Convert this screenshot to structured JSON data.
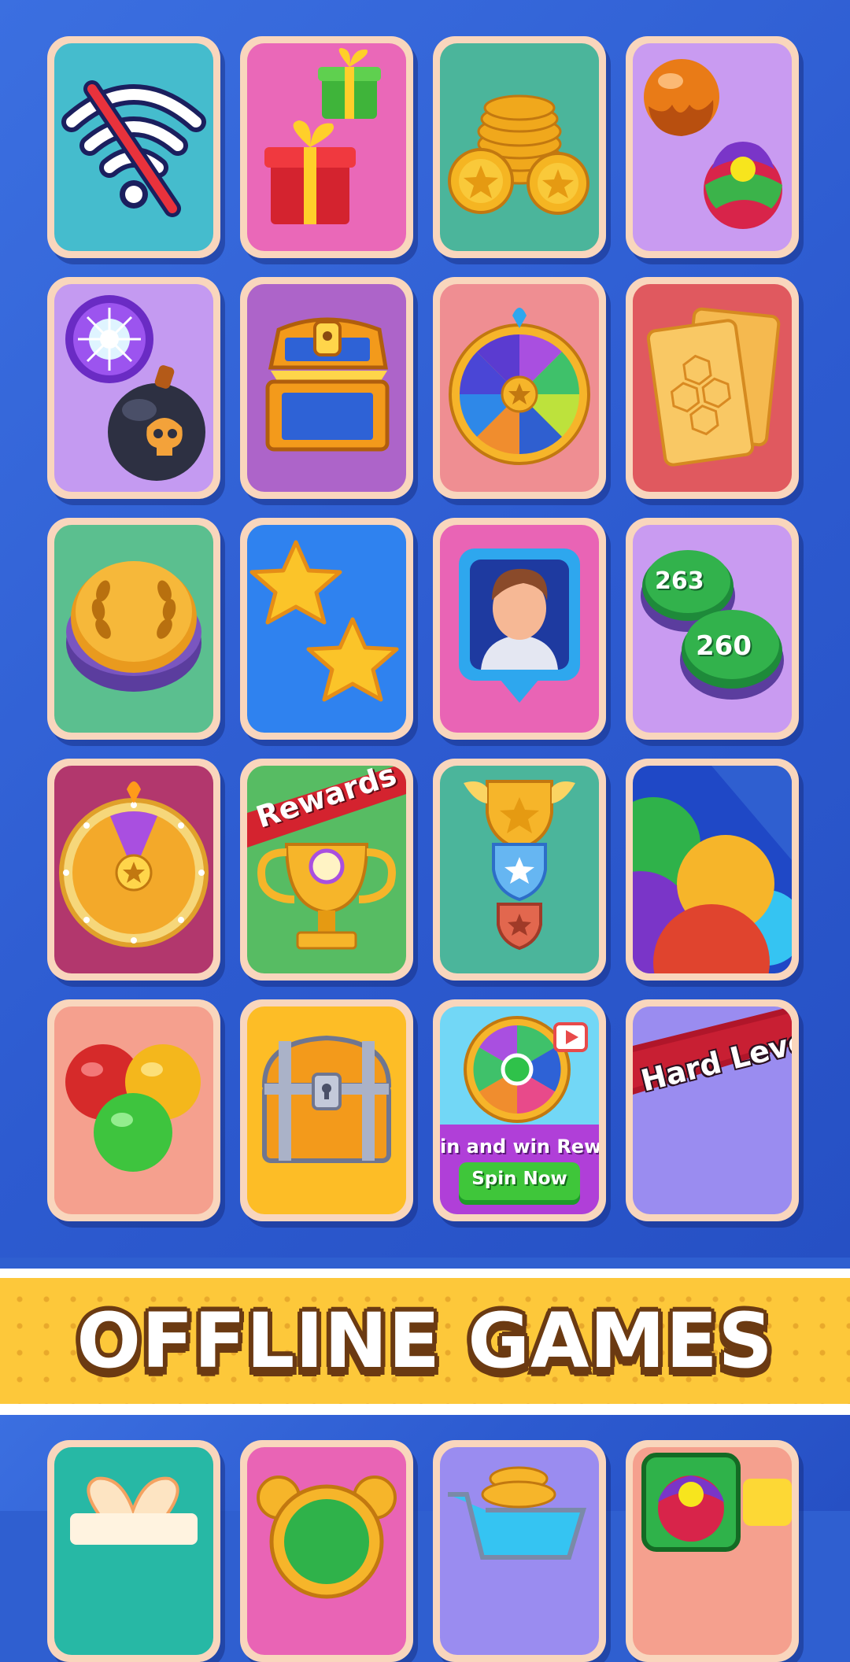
{
  "banner": {
    "title": "OFFLINE GAMES"
  },
  "tiles": [
    {
      "name": "no-wifi-icon",
      "bg": "#45bccd"
    },
    {
      "name": "gift-boxes-icon",
      "bg": "#ea68b8"
    },
    {
      "name": "gold-coins-icon",
      "bg": "#4bb59b"
    },
    {
      "name": "color-balls-icon",
      "bg": "#c99bf1"
    },
    {
      "name": "lightning-orb-bomb-icon",
      "bg": "#c49af1"
    },
    {
      "name": "treasure-chest-open-icon",
      "bg": "#ad64c9"
    },
    {
      "name": "prize-wheel-icon",
      "bg": "#ef8e92"
    },
    {
      "name": "hex-cards-icon",
      "bg": "#e0595f"
    },
    {
      "name": "laurel-button-icon",
      "bg": "#5bbf8f"
    },
    {
      "name": "two-stars-icon",
      "bg": "#2f82ef"
    },
    {
      "name": "profile-avatar-icon",
      "bg": "#e964b5"
    },
    {
      "name": "numbered-balls-icon",
      "bg": "#c99bf1",
      "labels": [
        "263",
        "260"
      ]
    },
    {
      "name": "lucky-wheel-icon",
      "bg": "#b2376d"
    },
    {
      "name": "rewards-trophy-icon",
      "bg": "#57bc63",
      "label": "Rewards"
    },
    {
      "name": "rank-badges-icon",
      "bg": "#4bb59b"
    },
    {
      "name": "stacked-balls-icon",
      "bg": "#1f48c6"
    },
    {
      "name": "rgb-balls-icon",
      "bg": "#f5a08e"
    },
    {
      "name": "treasure-chest-closed-icon",
      "bg": "#fdbd26"
    },
    {
      "name": "spin-now-ad-icon",
      "bg": "#72d7f6",
      "label": "in and win Rewa",
      "button": "Spin Now"
    },
    {
      "name": "hard-level-icon",
      "bg": "#9a8cf0",
      "label": "Hard Leve"
    }
  ],
  "bottom_tiles": [
    {
      "name": "gift-bow-icon",
      "bg": "#27b8a5"
    },
    {
      "name": "alarm-clock-icon",
      "bg": "#e964b5"
    },
    {
      "name": "coin-cart-icon",
      "bg": "#9a8cf0"
    },
    {
      "name": "ball-frame-icon",
      "bg": "#f5a08e"
    }
  ]
}
